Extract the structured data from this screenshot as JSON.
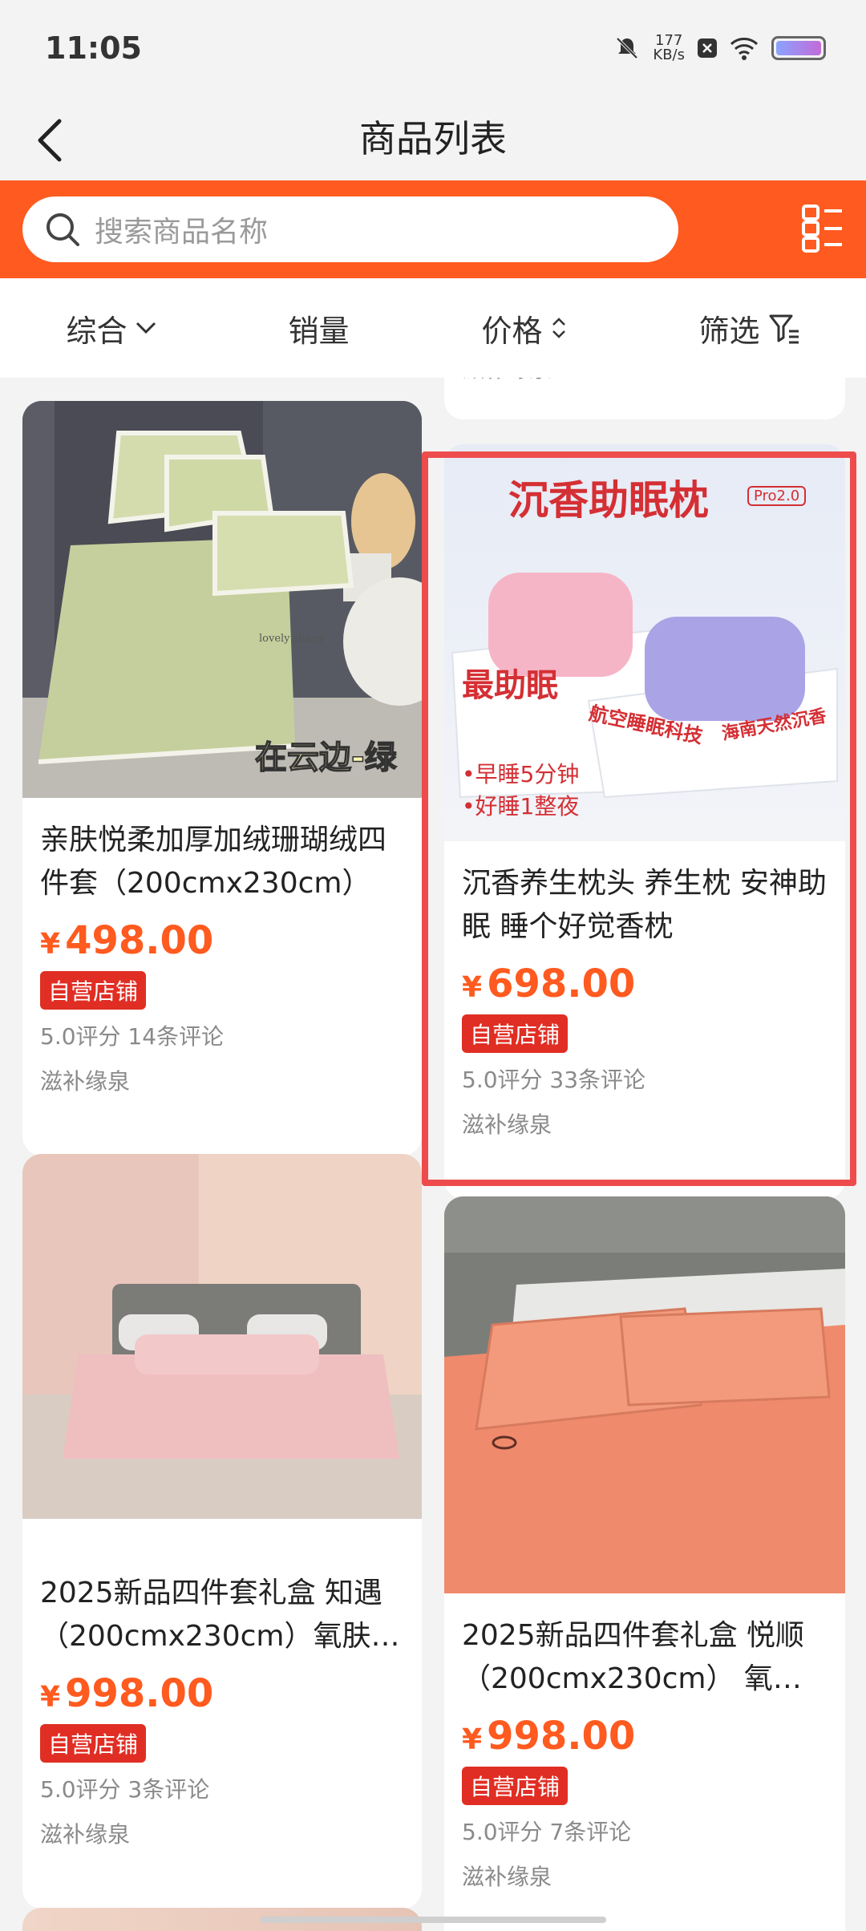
{
  "status": {
    "time": "11:05",
    "speed_value": "177",
    "speed_unit": "KB/s"
  },
  "header": {
    "title": "商品列表"
  },
  "search": {
    "placeholder": "搜索商品名称"
  },
  "sort": {
    "items": [
      "综合",
      "销量",
      "价格",
      "筛选"
    ]
  },
  "colors": {
    "accent": "#ff5a1f",
    "badge": "#e02e24",
    "highlight": "#ee4c4c"
  },
  "top_partial": {
    "shop": "滋补缘泉"
  },
  "products": [
    {
      "name": "亲肤悦柔加厚加绒珊瑚绒四件套（200cmx230cm）",
      "currency": "¥",
      "price": "498.00",
      "badge": "自营店铺",
      "rating": "5.0评分 14条评论",
      "shop": "滋补缘泉",
      "image": {
        "overlay": "在云边-绿"
      }
    },
    {
      "name": "沉香养生枕头 养生枕 安神助眠 睡个好觉香枕",
      "currency": "¥",
      "price": "698.00",
      "badge": "自营店铺",
      "rating": "5.0评分 33条评论",
      "shop": "滋补缘泉",
      "image": {
        "title": "沉香助眠枕",
        "tag": "Pro2.0",
        "box_left": "最助眠",
        "label1": "航空睡眠科技",
        "label2": "海南天然沉香",
        "bullet1": "•早睡5分钟",
        "bullet2": "•好睡1整夜"
      }
    },
    {
      "name": "2025新品四件套礼盒 知遇（200cmx230cm）氧肤…",
      "currency": "¥",
      "price": "998.00",
      "badge": "自营店铺",
      "rating": "5.0评分 3条评论",
      "shop": "滋补缘泉"
    },
    {
      "name": "2025新品四件套礼盒 悦顺（200cmx230cm） 氧肤…",
      "currency": "¥",
      "price": "998.00",
      "badge": "自营店铺",
      "rating": "5.0评分 7条评论",
      "shop": "滋补缘泉"
    }
  ]
}
